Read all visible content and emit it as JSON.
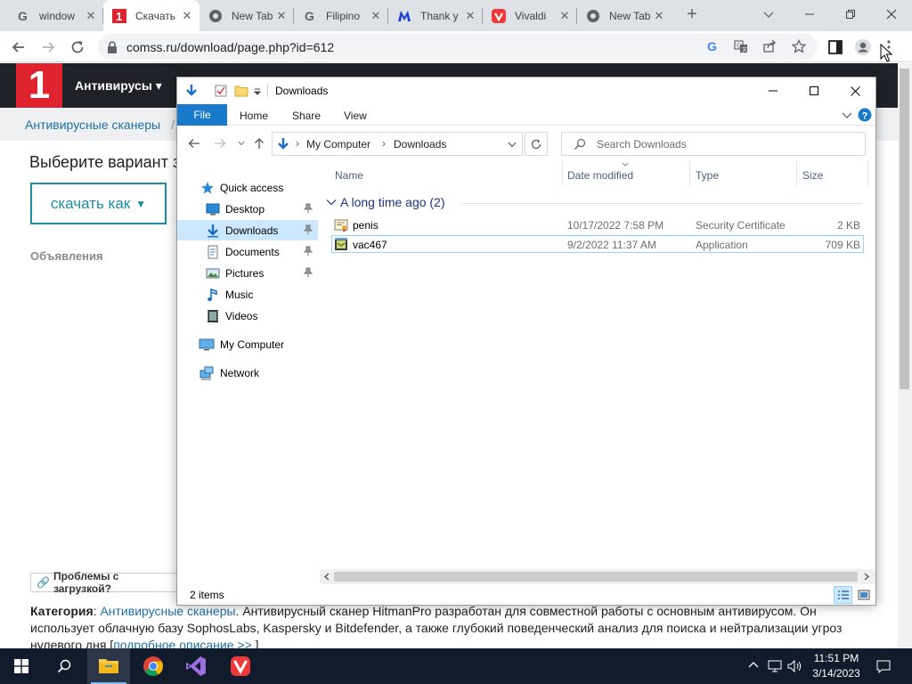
{
  "browser": {
    "tabs": [
      {
        "title": "window",
        "icon": "google-icon",
        "active": false
      },
      {
        "title": "Скачать",
        "icon": "comss-icon",
        "active": true
      },
      {
        "title": "New Tab",
        "icon": "chrome-icon",
        "active": false
      },
      {
        "title": "Filipino",
        "icon": "google-icon",
        "active": false
      },
      {
        "title": "Thank y",
        "icon": "malwarebytes-icon",
        "active": false
      },
      {
        "title": "Vivaldi",
        "icon": "vivaldi-icon",
        "active": false
      },
      {
        "title": "New Tab",
        "icon": "chrome-icon",
        "active": false
      }
    ],
    "url": "comss.ru/download/page.php?id=612"
  },
  "site": {
    "logo": "1",
    "nav_label": "Антивирусы",
    "breadcrumb": "Антивирусные сканеры",
    "breadcrumb_sep": "/",
    "choose_text": "Выберите вариант з",
    "download_button": "скачать как",
    "ads_label": "Объявления",
    "problems_button": "Проблемы с загрузкой?",
    "category_label": "Категория",
    "category_link": "Антивирусные сканеры",
    "category_text": ". Антивирусный сканер HitmanPro разработан для совместной работы с основным антивирусом. Он использует облачную базу SophosLabs, Kaspersky и Bitdefender, а также глубокий поведенческий анализ для поиска и нейтрализации угроз нулевого дня [",
    "details_link": "подробное описание >>",
    "details_close": " ]"
  },
  "explorer": {
    "title": "Downloads",
    "ribbon_tabs": [
      "File",
      "Home",
      "Share",
      "View"
    ],
    "address": [
      "My Computer",
      "Downloads"
    ],
    "search_placeholder": "Search Downloads",
    "nav": [
      {
        "label": "Quick access",
        "icon": "star-icon",
        "pinned": false,
        "selected": false
      },
      {
        "label": "Desktop",
        "icon": "desktop-icon",
        "pinned": true,
        "selected": false
      },
      {
        "label": "Downloads",
        "icon": "download-icon",
        "pinned": true,
        "selected": true
      },
      {
        "label": "Documents",
        "icon": "documents-icon",
        "pinned": true,
        "selected": false
      },
      {
        "label": "Pictures",
        "icon": "pictures-icon",
        "pinned": true,
        "selected": false
      },
      {
        "label": "Music",
        "icon": "music-icon",
        "pinned": false,
        "selected": false
      },
      {
        "label": "Videos",
        "icon": "videos-icon",
        "pinned": false,
        "selected": false
      },
      {
        "label": "My Computer",
        "icon": "computer-icon",
        "pinned": false,
        "selected": false
      },
      {
        "label": "Network",
        "icon": "network-icon",
        "pinned": false,
        "selected": false
      }
    ],
    "columns": {
      "name": "Name",
      "date": "Date modified",
      "type": "Type",
      "size": "Size"
    },
    "group": "A long time ago (2)",
    "files": [
      {
        "name": "penis",
        "date": "10/17/2022 7:58 PM",
        "type": "Security Certificate",
        "size": "2 KB",
        "icon": "certificate-icon",
        "selected": false
      },
      {
        "name": "vac467",
        "date": "9/2/2022 11:37 AM",
        "type": "Application",
        "size": "709 KB",
        "icon": "application-icon",
        "selected": true
      }
    ],
    "status": "2 items"
  },
  "taskbar": {
    "time": "11:51 PM",
    "date": "3/14/2023"
  }
}
